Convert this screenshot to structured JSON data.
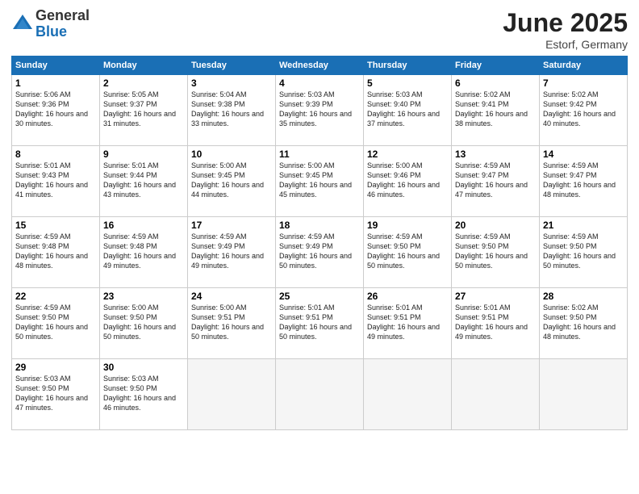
{
  "header": {
    "logo_general": "General",
    "logo_blue": "Blue",
    "month": "June 2025",
    "location": "Estorf, Germany"
  },
  "weekdays": [
    "Sunday",
    "Monday",
    "Tuesday",
    "Wednesday",
    "Thursday",
    "Friday",
    "Saturday"
  ],
  "weeks": [
    [
      {
        "day": "1",
        "sunrise": "Sunrise: 5:06 AM",
        "sunset": "Sunset: 9:36 PM",
        "daylight": "Daylight: 16 hours and 30 minutes."
      },
      {
        "day": "2",
        "sunrise": "Sunrise: 5:05 AM",
        "sunset": "Sunset: 9:37 PM",
        "daylight": "Daylight: 16 hours and 31 minutes."
      },
      {
        "day": "3",
        "sunrise": "Sunrise: 5:04 AM",
        "sunset": "Sunset: 9:38 PM",
        "daylight": "Daylight: 16 hours and 33 minutes."
      },
      {
        "day": "4",
        "sunrise": "Sunrise: 5:03 AM",
        "sunset": "Sunset: 9:39 PM",
        "daylight": "Daylight: 16 hours and 35 minutes."
      },
      {
        "day": "5",
        "sunrise": "Sunrise: 5:03 AM",
        "sunset": "Sunset: 9:40 PM",
        "daylight": "Daylight: 16 hours and 37 minutes."
      },
      {
        "day": "6",
        "sunrise": "Sunrise: 5:02 AM",
        "sunset": "Sunset: 9:41 PM",
        "daylight": "Daylight: 16 hours and 38 minutes."
      },
      {
        "day": "7",
        "sunrise": "Sunrise: 5:02 AM",
        "sunset": "Sunset: 9:42 PM",
        "daylight": "Daylight: 16 hours and 40 minutes."
      }
    ],
    [
      {
        "day": "8",
        "sunrise": "Sunrise: 5:01 AM",
        "sunset": "Sunset: 9:43 PM",
        "daylight": "Daylight: 16 hours and 41 minutes."
      },
      {
        "day": "9",
        "sunrise": "Sunrise: 5:01 AM",
        "sunset": "Sunset: 9:44 PM",
        "daylight": "Daylight: 16 hours and 43 minutes."
      },
      {
        "day": "10",
        "sunrise": "Sunrise: 5:00 AM",
        "sunset": "Sunset: 9:45 PM",
        "daylight": "Daylight: 16 hours and 44 minutes."
      },
      {
        "day": "11",
        "sunrise": "Sunrise: 5:00 AM",
        "sunset": "Sunset: 9:45 PM",
        "daylight": "Daylight: 16 hours and 45 minutes."
      },
      {
        "day": "12",
        "sunrise": "Sunrise: 5:00 AM",
        "sunset": "Sunset: 9:46 PM",
        "daylight": "Daylight: 16 hours and 46 minutes."
      },
      {
        "day": "13",
        "sunrise": "Sunrise: 4:59 AM",
        "sunset": "Sunset: 9:47 PM",
        "daylight": "Daylight: 16 hours and 47 minutes."
      },
      {
        "day": "14",
        "sunrise": "Sunrise: 4:59 AM",
        "sunset": "Sunset: 9:47 PM",
        "daylight": "Daylight: 16 hours and 48 minutes."
      }
    ],
    [
      {
        "day": "15",
        "sunrise": "Sunrise: 4:59 AM",
        "sunset": "Sunset: 9:48 PM",
        "daylight": "Daylight: 16 hours and 48 minutes."
      },
      {
        "day": "16",
        "sunrise": "Sunrise: 4:59 AM",
        "sunset": "Sunset: 9:48 PM",
        "daylight": "Daylight: 16 hours and 49 minutes."
      },
      {
        "day": "17",
        "sunrise": "Sunrise: 4:59 AM",
        "sunset": "Sunset: 9:49 PM",
        "daylight": "Daylight: 16 hours and 49 minutes."
      },
      {
        "day": "18",
        "sunrise": "Sunrise: 4:59 AM",
        "sunset": "Sunset: 9:49 PM",
        "daylight": "Daylight: 16 hours and 50 minutes."
      },
      {
        "day": "19",
        "sunrise": "Sunrise: 4:59 AM",
        "sunset": "Sunset: 9:50 PM",
        "daylight": "Daylight: 16 hours and 50 minutes."
      },
      {
        "day": "20",
        "sunrise": "Sunrise: 4:59 AM",
        "sunset": "Sunset: 9:50 PM",
        "daylight": "Daylight: 16 hours and 50 minutes."
      },
      {
        "day": "21",
        "sunrise": "Sunrise: 4:59 AM",
        "sunset": "Sunset: 9:50 PM",
        "daylight": "Daylight: 16 hours and 50 minutes."
      }
    ],
    [
      {
        "day": "22",
        "sunrise": "Sunrise: 4:59 AM",
        "sunset": "Sunset: 9:50 PM",
        "daylight": "Daylight: 16 hours and 50 minutes."
      },
      {
        "day": "23",
        "sunrise": "Sunrise: 5:00 AM",
        "sunset": "Sunset: 9:50 PM",
        "daylight": "Daylight: 16 hours and 50 minutes."
      },
      {
        "day": "24",
        "sunrise": "Sunrise: 5:00 AM",
        "sunset": "Sunset: 9:51 PM",
        "daylight": "Daylight: 16 hours and 50 minutes."
      },
      {
        "day": "25",
        "sunrise": "Sunrise: 5:01 AM",
        "sunset": "Sunset: 9:51 PM",
        "daylight": "Daylight: 16 hours and 50 minutes."
      },
      {
        "day": "26",
        "sunrise": "Sunrise: 5:01 AM",
        "sunset": "Sunset: 9:51 PM",
        "daylight": "Daylight: 16 hours and 49 minutes."
      },
      {
        "day": "27",
        "sunrise": "Sunrise: 5:01 AM",
        "sunset": "Sunset: 9:51 PM",
        "daylight": "Daylight: 16 hours and 49 minutes."
      },
      {
        "day": "28",
        "sunrise": "Sunrise: 5:02 AM",
        "sunset": "Sunset: 9:50 PM",
        "daylight": "Daylight: 16 hours and 48 minutes."
      }
    ],
    [
      {
        "day": "29",
        "sunrise": "Sunrise: 5:03 AM",
        "sunset": "Sunset: 9:50 PM",
        "daylight": "Daylight: 16 hours and 47 minutes."
      },
      {
        "day": "30",
        "sunrise": "Sunrise: 5:03 AM",
        "sunset": "Sunset: 9:50 PM",
        "daylight": "Daylight: 16 hours and 46 minutes."
      },
      null,
      null,
      null,
      null,
      null
    ]
  ]
}
